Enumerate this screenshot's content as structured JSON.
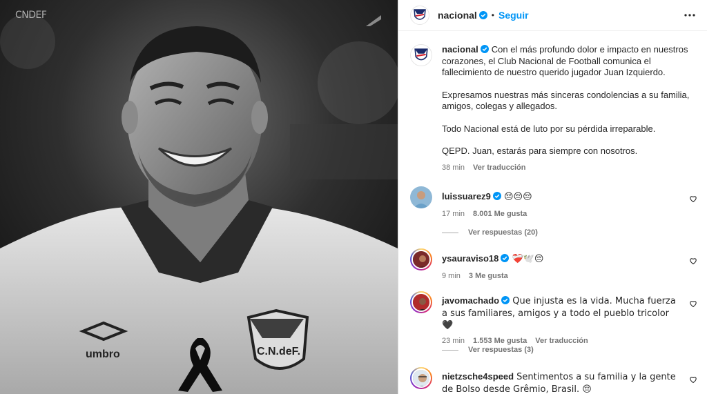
{
  "media": {
    "watermark": "CNDEF"
  },
  "post": {
    "username": "nacional",
    "follow_label": "Seguir",
    "caption": {
      "paragraphs": [
        "Con el más profundo dolor e impacto en nuestros corazones, el Club Nacional de Football comunica el fallecimiento de nuestro querido jugador Juan Izquierdo.",
        "Expresamos nuestras más sinceras condolencias a su familia, amigos, colegas y allegados.",
        "Todo Nacional está de luto por su pérdida irreparable.",
        "QEPD. Juan, estarás para siempre con nosotros."
      ],
      "time": "38 min",
      "translate": "Ver traducción"
    }
  },
  "comments": [
    {
      "username": "luissuarez9",
      "verified": true,
      "text": " 😔😔😔",
      "time": "17 min",
      "likes": "8.001 Me gusta",
      "reply_label": "",
      "view_replies": "Ver respuestas (20)"
    },
    {
      "username": "ysauraviso18",
      "verified": true,
      "text": " ❤️‍🩹🕊️😔",
      "time": "9 min",
      "likes": "3 Me gusta",
      "reply_label": "",
      "view_replies": ""
    },
    {
      "username": "javomachado",
      "verified": true,
      "text": " Que injusta es la vida. Mucha fuerza a sus familiares, amigos y a todo el pueblo tricolor 🖤",
      "time": "23 min",
      "likes": "1.553 Me gusta",
      "reply_label": "Ver traducción",
      "view_replies": "Ver respuestas (3)"
    },
    {
      "username": "nietzsche4speed",
      "verified": false,
      "text": " Sentimentos a su familia y la gente de Bolso desde Grêmio, Brasil. 😔",
      "time": "",
      "likes": "",
      "reply_label": "",
      "view_replies": ""
    }
  ],
  "colors": {
    "accent": "#0095f6",
    "verified": "#0095f6",
    "secondary_text": "#737373",
    "divider": "#dbdbdb"
  },
  "icons": [
    "more-options-icon",
    "verified-badge-icon",
    "heart-icon",
    "black-ribbon-icon",
    "club-crest-icon"
  ]
}
